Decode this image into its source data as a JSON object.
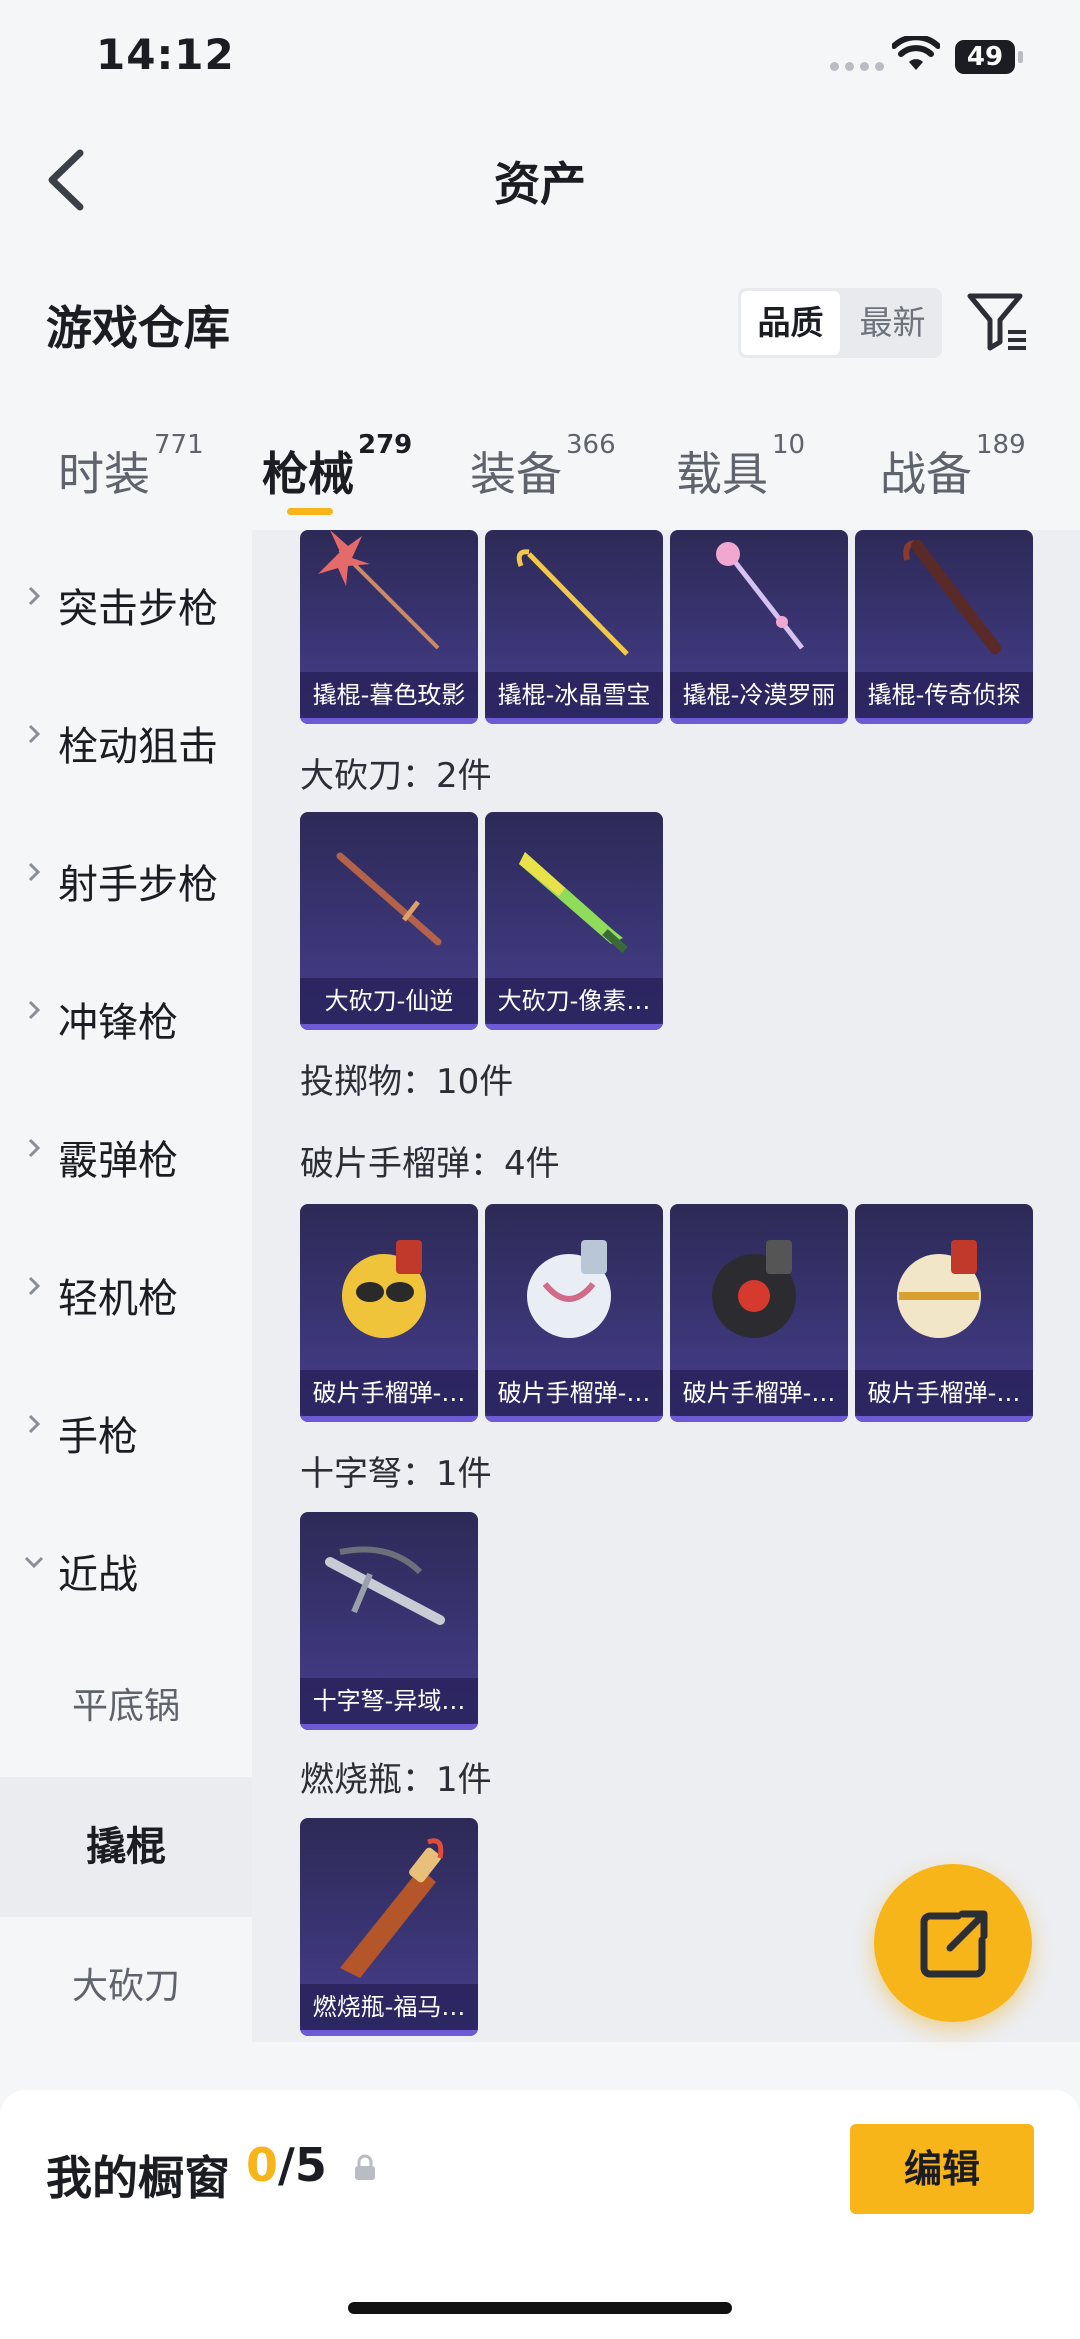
{
  "status_bar": {
    "time": "14:12",
    "battery": "49"
  },
  "header": {
    "title": "资产"
  },
  "warehouse": {
    "title": "游戏仓库",
    "sort_options": [
      "品质",
      "最新"
    ],
    "active_sort": "品质"
  },
  "tabs": [
    {
      "label": "时装",
      "count": "771"
    },
    {
      "label": "枪械",
      "count": "279",
      "active": true
    },
    {
      "label": "装备",
      "count": "366"
    },
    {
      "label": "载具",
      "count": "10"
    },
    {
      "label": "战备",
      "count": "189"
    }
  ],
  "sidebar": {
    "categories": [
      "突击步枪",
      "栓动狙击",
      "射手步枪",
      "冲锋枪",
      "霰弹枪",
      "轻机枪",
      "手枪",
      "近战"
    ],
    "sub_items": [
      "平底锅",
      "撬棍",
      "大砍刀"
    ],
    "active_sub": "撬棍"
  },
  "content": {
    "top_cards": [
      "撬棍-暮色玫影",
      "撬棍-冰晶雪宝",
      "撬棍-冷漠罗丽",
      "撬棍-传奇侦探"
    ],
    "groups": [
      {
        "label": "大砍刀：2件",
        "items": [
          "大砍刀-仙逆",
          "大砍刀-像素…"
        ]
      },
      {
        "label": "投掷物：10件",
        "items": []
      },
      {
        "label": "破片手榴弹：4件",
        "items": [
          "破片手榴弹-…",
          "破片手榴弹-…",
          "破片手榴弹-…",
          "破片手榴弹-…"
        ]
      },
      {
        "label": "十字弩：1件",
        "items": [
          "十字弩-异域…"
        ]
      },
      {
        "label": "燃烧瓶：1件",
        "items": [
          "燃烧瓶-福马…"
        ]
      }
    ]
  },
  "showcase": {
    "title": "我的橱窗",
    "current": "0",
    "total": "/5",
    "edit_label": "编辑"
  },
  "colors": {
    "accent": "#f7b51a",
    "card_bg": "#3a3574",
    "card_edge": "#6d5ad4"
  }
}
